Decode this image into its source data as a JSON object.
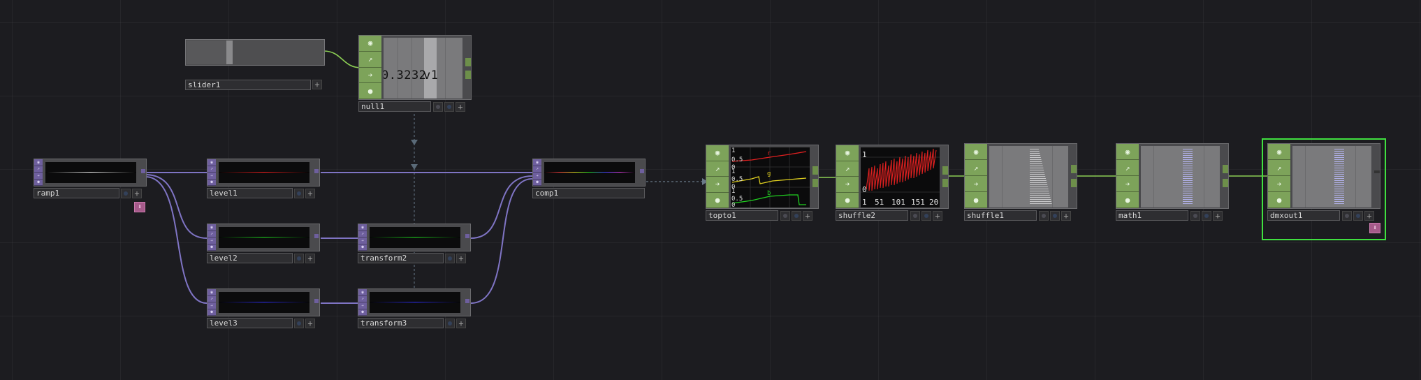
{
  "nodes": {
    "slider1": {
      "label": "slider1"
    },
    "null1": {
      "label": "null1",
      "readout_value": "0.3232",
      "readout_channel": "v1"
    },
    "ramp1": {
      "label": "ramp1"
    },
    "level1": {
      "label": "level1"
    },
    "level2": {
      "label": "level2"
    },
    "level3": {
      "label": "level3"
    },
    "transform2": {
      "label": "transform2"
    },
    "transform3": {
      "label": "transform3"
    },
    "comp1": {
      "label": "comp1"
    },
    "topto1": {
      "label": "topto1",
      "ticks": [
        "1",
        "0.5",
        "0",
        "1",
        "0.5",
        "0",
        "1",
        "0.5",
        "0"
      ],
      "channels": [
        "r",
        "g",
        "b"
      ]
    },
    "shuffle2": {
      "label": "shuffle2",
      "y_ticks": [
        "1",
        "0"
      ],
      "x_ticks": [
        "1",
        "51",
        "101",
        "151",
        "20"
      ]
    },
    "shuffle1": {
      "label": "shuffle1"
    },
    "math1": {
      "label": "math1"
    },
    "dmxout1": {
      "label": "dmxout1"
    }
  },
  "colors": {
    "chop": "#7da35a",
    "top": "#6e5f9e",
    "wire_chop": "#8ccf54",
    "wire_top": "#7f74c4",
    "selection": "#40e040"
  },
  "icons": [
    "viewer-icon",
    "graph-icon",
    "arrow-right-icon",
    "export-icon",
    "plus-icon",
    "flag-dot-icon",
    "down-arrow-icon"
  ]
}
